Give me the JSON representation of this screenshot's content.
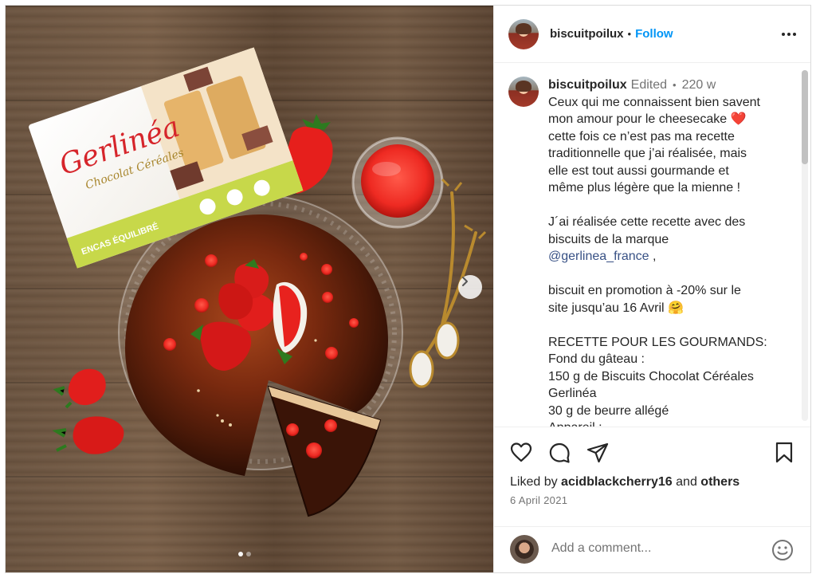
{
  "post": {
    "username": "biscuitpoilux",
    "follow_label": "Follow",
    "separator": "•",
    "caption": {
      "username": "biscuitpoilux",
      "edited": "Edited",
      "separator": "•",
      "age": "220 w",
      "lines": [
        "Ceux qui me connaissent bien savent",
        "mon amour pour le cheesecake ❤️",
        "cette fois ce n’est pas ma recette",
        "traditionnelle que j’ai réalisée, mais",
        "elle est tout aussi gourmande et",
        "même plus légère que la mienne !",
        "",
        "J´ai réalisée cette recette avec des",
        "biscuits de la marque",
        "",
        "",
        "biscuit en promotion à -20% sur le",
        "site jusqu’au 16 Avril 🤗",
        "",
        "RECETTE POUR LES GOURMANDS:",
        "Fond du gâteau :",
        "150 g de Biscuits Chocolat Céréales",
        "Gerlinéa",
        "30 g de beurre allégé",
        "Appareil :"
      ],
      "mention": "@gerlinea_france",
      "mention_suffix": " ,"
    },
    "likes": {
      "prefix": "Liked by ",
      "user": "acidblackcherry16",
      "and": " and ",
      "others": "others"
    },
    "date": "6 April 2021",
    "comment_placeholder": "Add a comment...",
    "icons": {
      "like": "heart-icon",
      "comment": "comment-icon",
      "share": "share-icon",
      "save": "bookmark-icon",
      "more": "more-icon",
      "emoji": "emoji-icon",
      "next": "chevron-right-icon"
    },
    "colors": {
      "accent": "#0095f6",
      "text": "#262626",
      "muted": "#737373",
      "mention": "#385185"
    },
    "media": {
      "brand": "Gerlinéa",
      "product": "Chocolat Céréales",
      "slide_count": 2,
      "current_slide": 1
    }
  }
}
